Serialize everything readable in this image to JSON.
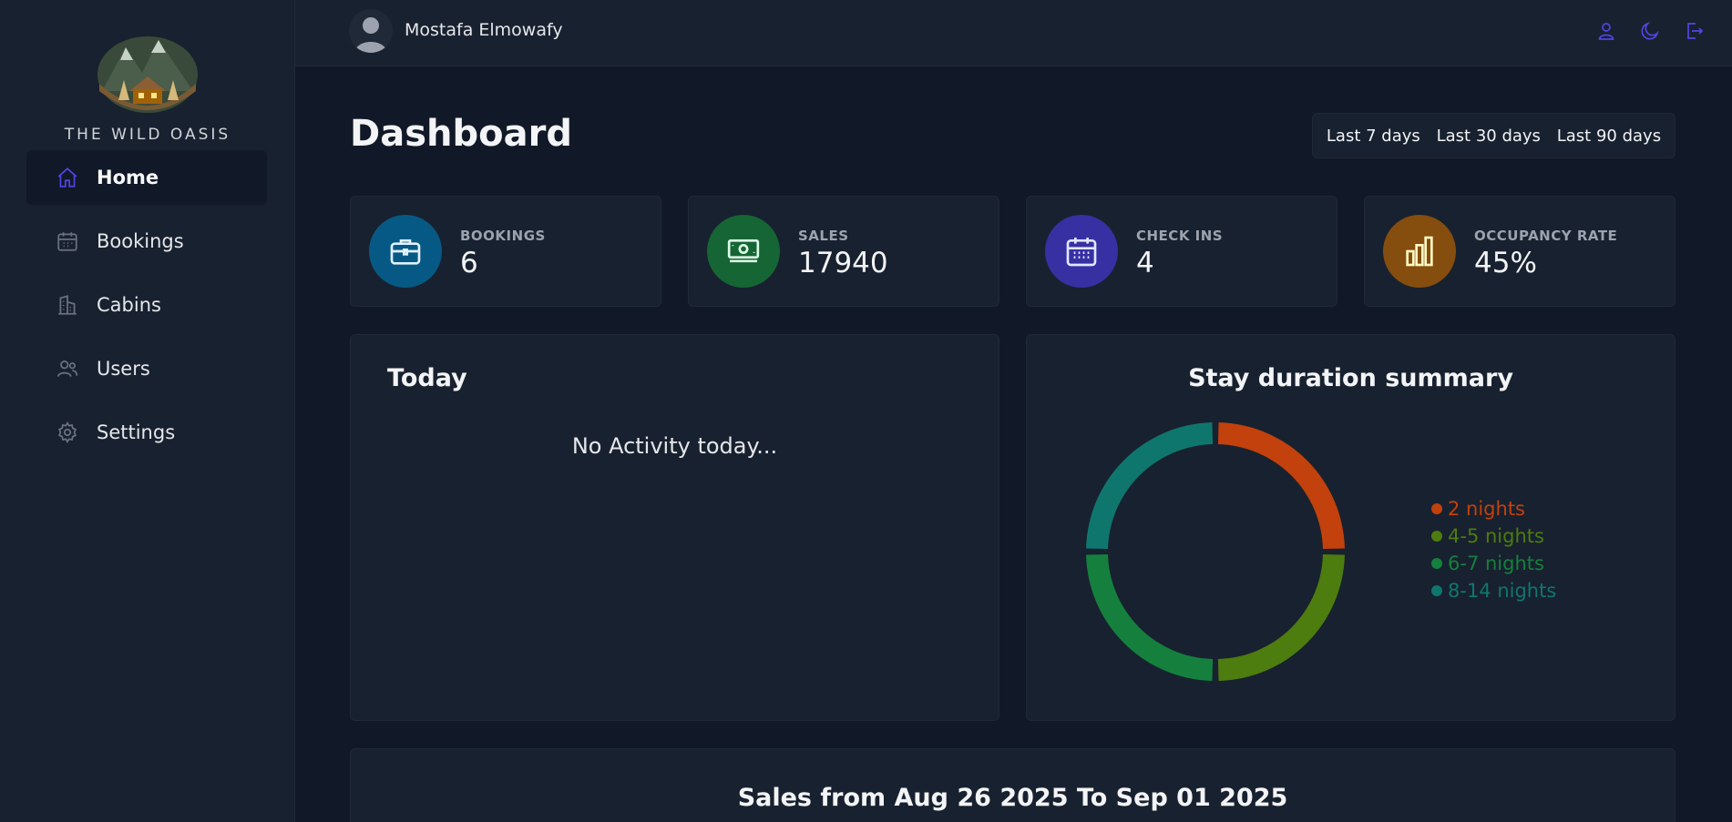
{
  "sidebar": {
    "brand": "THE WILD OASIS",
    "items": [
      {
        "label": "Home",
        "icon": "home-icon",
        "active": true
      },
      {
        "label": "Bookings",
        "icon": "calendar-icon",
        "active": false
      },
      {
        "label": "Cabins",
        "icon": "building-icon",
        "active": false
      },
      {
        "label": "Users",
        "icon": "users-icon",
        "active": false
      },
      {
        "label": "Settings",
        "icon": "gear-icon",
        "active": false
      }
    ]
  },
  "header": {
    "username": "Mostafa Elmowafy",
    "icons": [
      "user-icon",
      "moon-icon",
      "logout-icon"
    ]
  },
  "main": {
    "title": "Dashboard",
    "filters": [
      "Last 7 days",
      "Last 30 days",
      "Last 90 days"
    ],
    "stats": [
      {
        "label": "BOOKINGS",
        "value": "6",
        "icon": "briefcase-icon",
        "color": "#075985",
        "icon_color": "#e0f2fe"
      },
      {
        "label": "SALES",
        "value": "17940",
        "icon": "banknotes-icon",
        "color": "#166534",
        "icon_color": "#dcfce7"
      },
      {
        "label": "CHECK INS",
        "value": "4",
        "icon": "calendar-days-icon",
        "color": "#3730a3",
        "icon_color": "#e0e7ff"
      },
      {
        "label": "OCCUPANCY RATE",
        "value": "45%",
        "icon": "chart-bar-icon",
        "color": "#854d0e",
        "icon_color": "#fef9c3"
      }
    ],
    "today": {
      "title": "Today",
      "empty_text": "No Activity today..."
    },
    "duration": {
      "title": "Stay duration summary"
    },
    "sales": {
      "title": "Sales from Aug 26 2025 To Sep 01 2025"
    }
  },
  "chart_data": {
    "type": "pie",
    "categories": [
      "2 nights",
      "4-5 nights",
      "6-7 nights",
      "8-14 nights"
    ],
    "values": [
      1,
      1,
      1,
      1
    ],
    "colors": [
      "#c2410c",
      "#4d7c0f",
      "#15803d",
      "#0f766e"
    ],
    "legend": "right"
  }
}
